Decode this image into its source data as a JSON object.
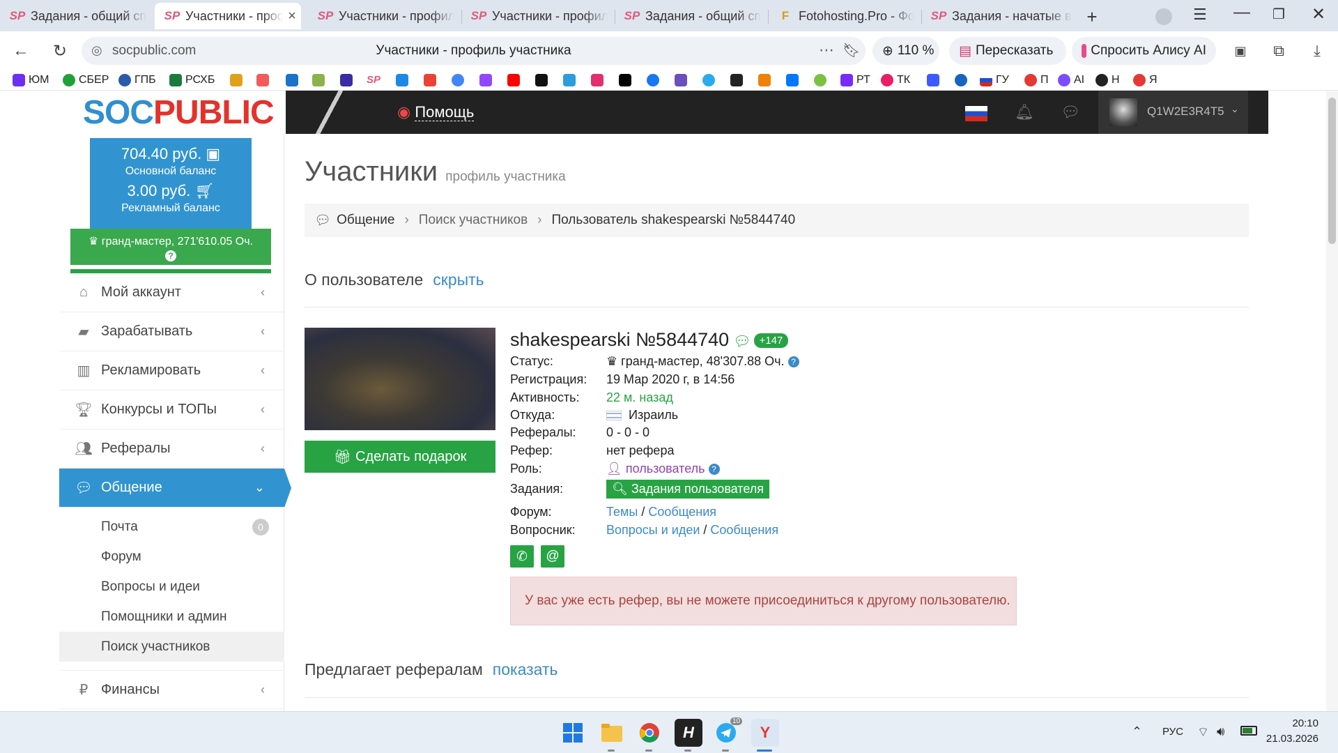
{
  "browser": {
    "tabs": [
      {
        "icon": "SP",
        "title": "Задания - общий спис"
      },
      {
        "icon": "SP",
        "title": "Участники - профиль",
        "active": true
      },
      {
        "icon": "SP",
        "title": "Участники - профиль"
      },
      {
        "icon": "SP",
        "title": "Участники - профиль"
      },
      {
        "icon": "SP",
        "title": "Задания - общий спис"
      },
      {
        "icon": "F",
        "title": "Fotohosting.Pro - Фото"
      },
      {
        "icon": "SP",
        "title": "Задания - начатые ва"
      }
    ],
    "url": "socpublic.com",
    "page_title": "Участники - профиль участника",
    "zoom": "110 %",
    "retell_label": "Пересказать",
    "alice_label": "Спросить Алису AI",
    "bookmarks": [
      "ЮМ",
      "СБЕР",
      "ГПБ",
      "РСХБ",
      "",
      "",
      "",
      "",
      "",
      "",
      "",
      "",
      "",
      "",
      "",
      "",
      "",
      "",
      "",
      "",
      "",
      "",
      "",
      "",
      "",
      "",
      "",
      "",
      "РТ",
      "ТК",
      "",
      "",
      "ГУ",
      "П",
      "AI",
      "Н",
      "Я"
    ]
  },
  "site": {
    "logo_soc": "SOC",
    "logo_public": "PUBLIC",
    "help_label": "Помощь",
    "username": "Q1W2E3R4T5"
  },
  "sidebar": {
    "main_balance": "704.40 руб.",
    "main_balance_label": "Основной баланс",
    "ad_balance": "3.00 руб.",
    "ad_balance_label": "Рекламный баланс",
    "rank": "гранд-мастер, 271'610.05 Оч.",
    "menu": [
      {
        "label": "Мой аккаунт",
        "icon": "home-icon"
      },
      {
        "label": "Зарабатывать",
        "icon": "briefcase-icon"
      },
      {
        "label": "Рекламировать",
        "icon": "bar-chart-icon"
      },
      {
        "label": "Конкурсы и ТОПы",
        "icon": "trophy-icon"
      },
      {
        "label": "Рефералы",
        "icon": "users-icon"
      },
      {
        "label": "Общение",
        "icon": "comments-icon",
        "active": true
      }
    ],
    "submenu": [
      {
        "label": "Почта",
        "badge": "0"
      },
      {
        "label": "Форум"
      },
      {
        "label": "Вопросы и идеи"
      },
      {
        "label": "Помощники и админ"
      },
      {
        "label": "Поиск участников",
        "selected": true
      }
    ],
    "finance_label": "Финансы"
  },
  "content": {
    "title": "Участники",
    "subtitle": "профиль участника",
    "breadcrumb": [
      "Общение",
      "Поиск участников",
      "Пользователь shakespearski №5844740"
    ],
    "about_label": "О пользователе",
    "hide_label": "скрыть",
    "gift_button": "Сделать подарок",
    "user_name": "shakespearski №5844740",
    "rating_badge": "+147",
    "fields": {
      "status_label": "Статус:",
      "status_value": "гранд-мастер, 48'307.88 Оч.",
      "reg_label": "Регистрация:",
      "reg_value": "19 Мар 2020 г, в 14:56",
      "activity_label": "Активность:",
      "activity_value": "22 м. назад",
      "from_label": "Откуда:",
      "from_value": "Израиль",
      "referrals_label": "Рефералы:",
      "referrals_value": "0 - 0 - 0",
      "referrer_label": "Рефер:",
      "referrer_value": "нет рефера",
      "role_label": "Роль:",
      "role_value": "пользователь",
      "tasks_label": "Задания:",
      "tasks_button": "Задания пользователя",
      "forum_label": "Форум:",
      "forum_topics": "Темы",
      "forum_messages": "Сообщения",
      "qa_label": "Вопросник:",
      "qa_ideas": "Вопросы и идеи",
      "qa_messages": "Сообщения"
    },
    "alert": "У вас уже есть рефер, вы не можете присоединиться к другому пользователю.",
    "offers_label": "Предлагает рефералам",
    "show_label": "показать"
  },
  "taskbar": {
    "lang": "РУС",
    "time": "20:10",
    "date": "21.03.2026",
    "telegram_badge": "10"
  }
}
